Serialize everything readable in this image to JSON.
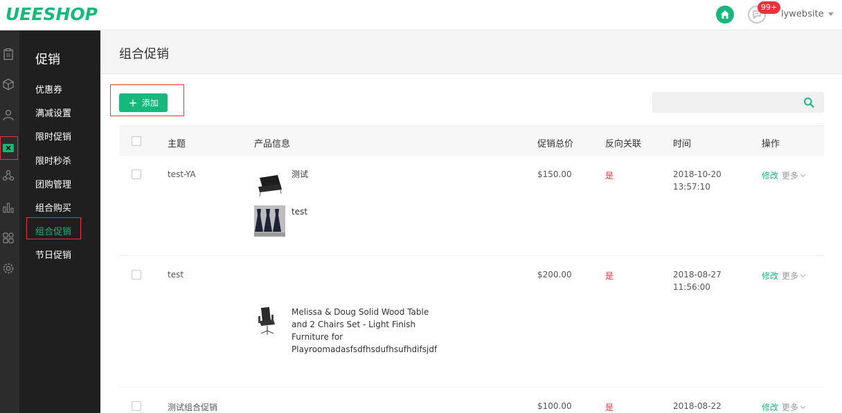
{
  "header": {
    "logo": "UEESHOP",
    "badge": "99+",
    "username": "lywebsite"
  },
  "sidebar": {
    "title": "促销",
    "items": [
      {
        "label": "优惠券"
      },
      {
        "label": "满减设置"
      },
      {
        "label": "限时促销"
      },
      {
        "label": "限时秒杀"
      },
      {
        "label": "团购管理"
      },
      {
        "label": "组合购买"
      },
      {
        "label": "组合促销",
        "active": true
      },
      {
        "label": "节日促销"
      }
    ]
  },
  "page": {
    "title": "组合促销",
    "add_label": "添加",
    "search_placeholder": ""
  },
  "table": {
    "columns": [
      "主题",
      "产品信息",
      "促销总价",
      "反向关联",
      "时间",
      "操作"
    ],
    "edit_label": "修改",
    "more_label": "更多",
    "rows": [
      {
        "subject": "test-YA",
        "products": [
          {
            "name": "测试",
            "img": "sofa-chair"
          },
          {
            "name": "test",
            "img": "dresses"
          }
        ],
        "price": "$150.00",
        "reverse": "是",
        "date": "2018-10-20",
        "time": "13:57:10"
      },
      {
        "subject": "test",
        "products": [
          {
            "name": "Melissa & Doug Solid Wood Table and 2 Chairs Set - Light Finish Furniture for Playroomadasfsdfhsdufhsufhdifsjdf",
            "img": "office-chair"
          }
        ],
        "price": "$200.00",
        "reverse": "是",
        "date": "2018-08-27",
        "time": "11:56:00"
      },
      {
        "subject": "测试组合促销",
        "products": [],
        "price": "$100.00",
        "reverse": "是",
        "date": "2018-08-22",
        "time": ""
      }
    ]
  },
  "colors": {
    "accent": "#17b87c",
    "danger": "#e8323c",
    "sidebar_bg": "#1f1f1f"
  }
}
